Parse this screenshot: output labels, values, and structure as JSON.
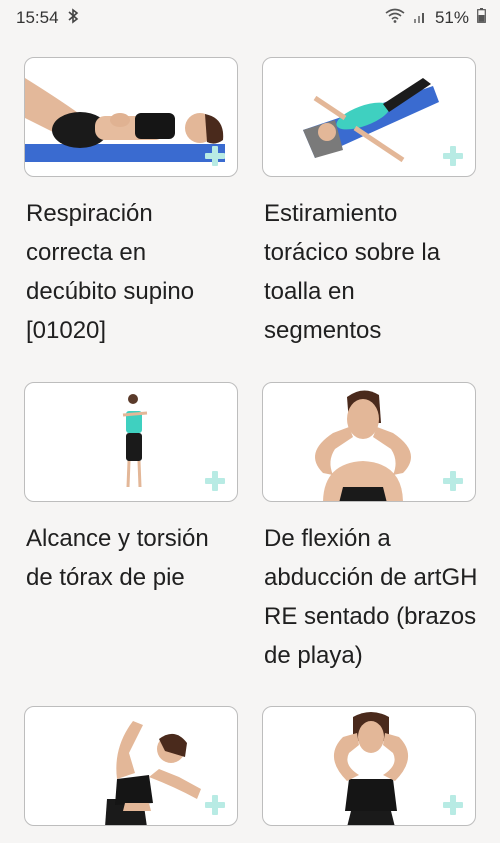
{
  "status_bar": {
    "time": "15:54",
    "battery": "51%",
    "icons": [
      "bluetooth-icon",
      "wifi-icon",
      "signal-icon",
      "battery-icon"
    ]
  },
  "exercises": [
    {
      "title": "Respiración correcta en decúbito supino [01020]"
    },
    {
      "title": "Estiramiento torácico sobre la toalla en segmentos"
    },
    {
      "title": "Alcance y torsión de tórax de pie"
    },
    {
      "title": "De flexión a abducción de artGH RE sentado (brazos de playa)"
    },
    {
      "title": ""
    },
    {
      "title": ""
    }
  ],
  "colors": {
    "background": "#f6f5f4",
    "card_border": "#bdbdbd",
    "add_icon": "#b8ebe4",
    "mat": "#3f6ccf",
    "shirt_teal": "#3fd0c0"
  }
}
